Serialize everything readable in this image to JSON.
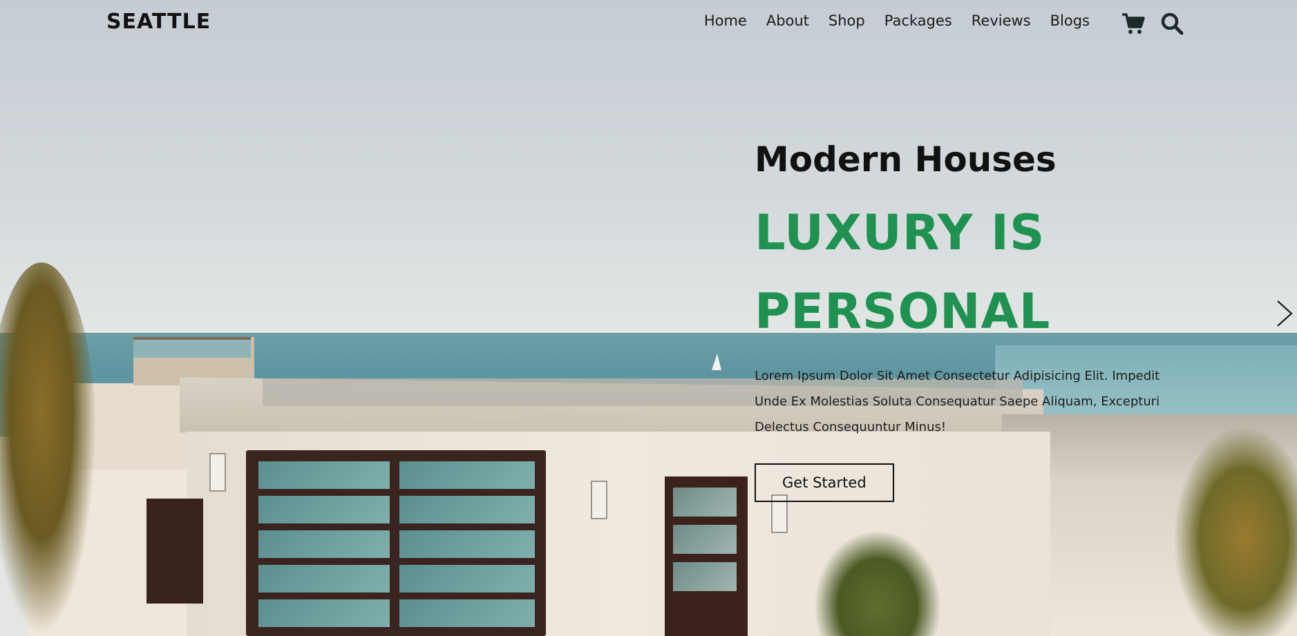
{
  "header": {
    "logo": "SEATTLE",
    "nav": [
      "Home",
      "About",
      "Shop",
      "Packages",
      "Reviews",
      "Blogs"
    ],
    "icons": [
      "shopping-cart-icon",
      "search-icon"
    ]
  },
  "hero": {
    "subtitle": "Modern Houses",
    "title_line1": "LUXURY IS",
    "title_line2": "PERSONAL",
    "description": "Lorem Ipsum Dolor Sit Amet Consectetur Adipisicing Elit. Impedit Unde Ex Molestias Soluta Consequatur Saepe Aliquam, Excepturi Delectus Consequuntur Minus!",
    "cta_label": "Get Started",
    "next_icon": "chevron-right-icon"
  },
  "colors": {
    "accent": "#1f9150",
    "text": "#111111"
  }
}
